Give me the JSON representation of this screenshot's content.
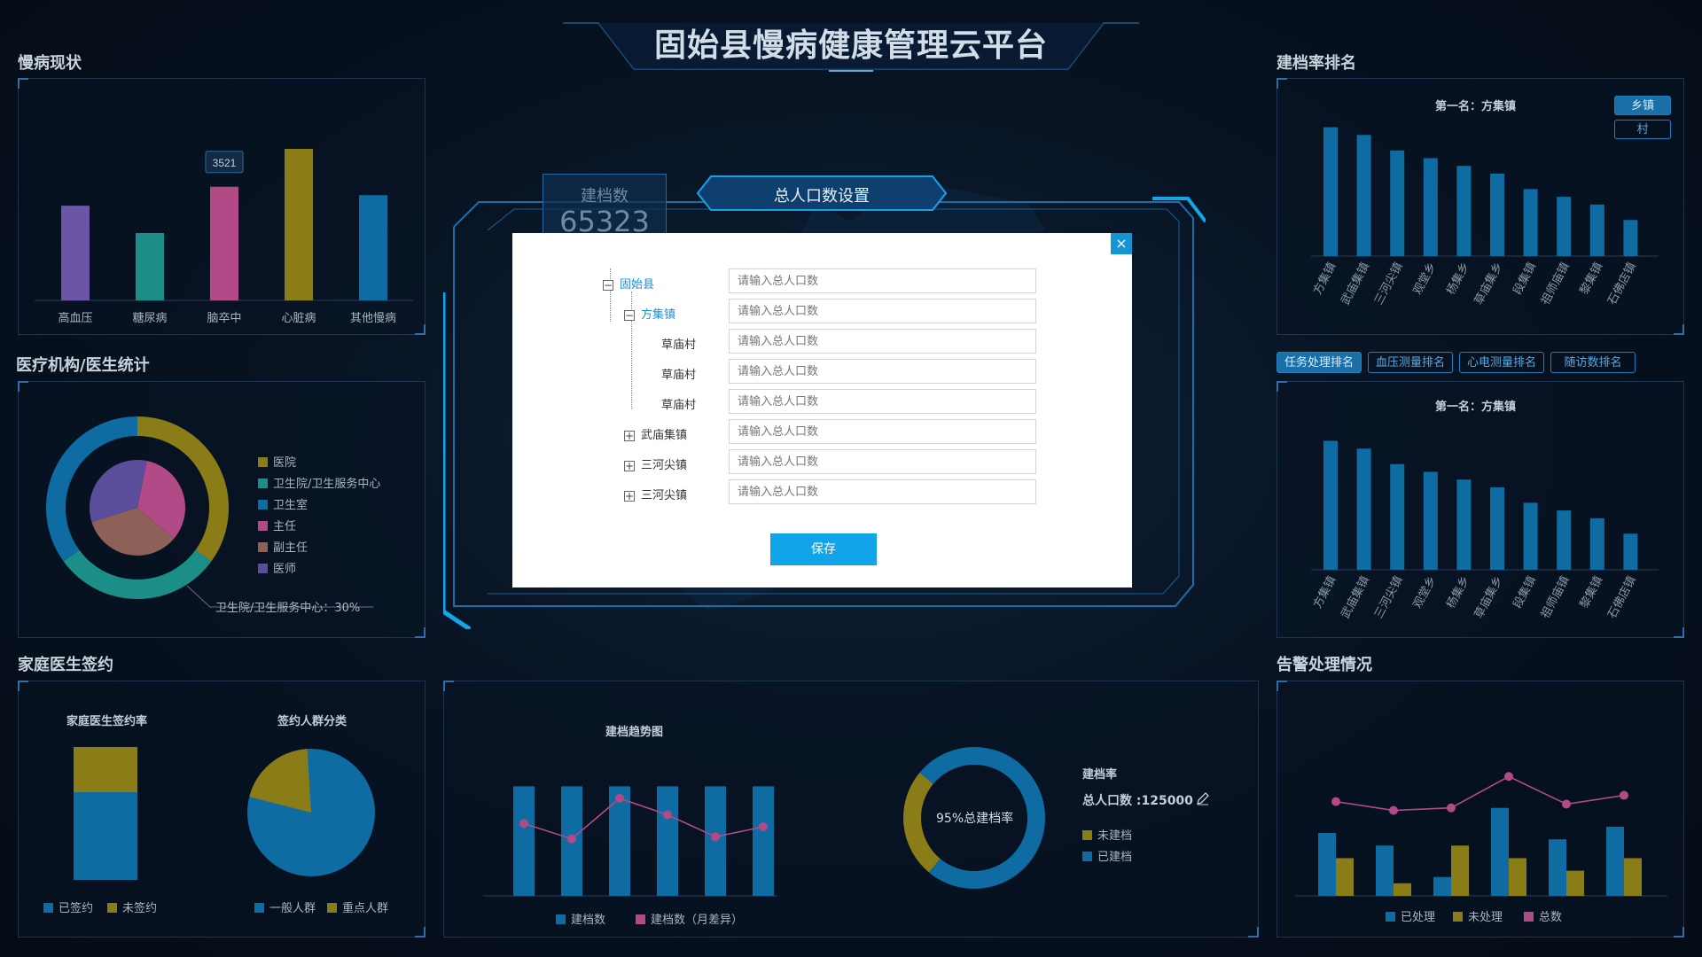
{
  "header": {
    "title": "固始县慢病健康管理云平台"
  },
  "chronic": {
    "title": "慢病现状",
    "chart_data": {
      "type": "bar",
      "categories": [
        "高血压",
        "糖尿病",
        "脑卒中",
        "心脏病",
        "其他慢病"
      ],
      "values": [
        2250,
        1600,
        2700,
        3600,
        2500
      ],
      "highlight": {
        "category": "脑卒中",
        "label": "3521"
      },
      "colors": [
        "#6a55a6",
        "#1b8f87",
        "#b14a86",
        "#8a7d17",
        "#0e6ca3"
      ],
      "ylim": [
        0,
        4000
      ]
    }
  },
  "medical": {
    "title": "医疗机构/医生统计",
    "legend": [
      "医院",
      "卫生院/卫生服务中心",
      "卫生室",
      "主任",
      "副主任",
      "医师"
    ],
    "legend_colors": [
      "#8a7d17",
      "#1b8f87",
      "#0e6ca3",
      "#b14a86",
      "#8d6157",
      "#5a4e9c"
    ],
    "callout": "卫生院/卫生服务中心：30%",
    "chart_data": [
      {
        "type": "pie",
        "name": "outer",
        "labels": [
          "医院",
          "卫生院/卫生服务中心",
          "卫生室"
        ],
        "values": [
          35,
          30,
          35
        ]
      },
      {
        "type": "pie",
        "name": "inner",
        "labels": [
          "主任",
          "副主任",
          "医师"
        ],
        "values": [
          33,
          34,
          33
        ]
      }
    ]
  },
  "family": {
    "title": "家庭医生签约",
    "rate_title": "家庭医生签约率",
    "crowd_title": "签约人群分类",
    "legend_rate": [
      "已签约",
      "未签约"
    ],
    "legend_crowd": [
      "一般人群",
      "重点人群"
    ],
    "colors": {
      "primary": "#0e6ca3",
      "secondary": "#8a7d17"
    },
    "chart_data": [
      {
        "type": "bar",
        "name": "签约率",
        "series": [
          {
            "name": "已签约",
            "values": [
              66
            ]
          },
          {
            "name": "未签约",
            "values": [
              34
            ]
          }
        ]
      },
      {
        "type": "pie",
        "name": "签约人群分类",
        "labels": [
          "一般人群",
          "重点人群"
        ],
        "values": [
          80,
          20
        ]
      }
    ]
  },
  "trend": {
    "title": "建档趋势图",
    "legend": [
      "建档数",
      "建档数（月差异）"
    ],
    "rate_title": "建档率",
    "total_label": "总人口数 :125000",
    "donut_text": "95%总建档率",
    "donut_legend": [
      "未建档",
      "已建档"
    ],
    "chart_data": [
      {
        "type": "bar",
        "series": [
          {
            "name": "建档数",
            "values": [
              100,
              100,
              100,
              100,
              100,
              100
            ]
          },
          {
            "name": "建档数（月差异）",
            "values": [
              66,
              52,
              89,
              74,
              54,
              63
            ]
          }
        ],
        "ylim": [
          0,
          110
        ]
      },
      {
        "type": "pie",
        "labels": [
          "未建档",
          "已建档"
        ],
        "values": [
          25,
          75
        ]
      }
    ]
  },
  "ranking": {
    "title": "建档率排名",
    "first": "第一名：方集镇",
    "first2": "第一名：方集镇",
    "scope_tabs": [
      "乡镇",
      "村"
    ],
    "tabs": [
      "任务处理排名",
      "血压测量排名",
      "心电测量排名",
      "随访数排名"
    ],
    "chart_data": [
      {
        "type": "bar",
        "categories": [
          "方集镇",
          "武庙集镇",
          "三河尖镇",
          "观堂乡",
          "杨集乡",
          "草庙集乡",
          "段集镇",
          "祖师庙镇",
          "黎集镇",
          "石佛店镇"
        ],
        "values": [
          100,
          94,
          82,
          76,
          70,
          64,
          52,
          46,
          40,
          28
        ],
        "ylim": [
          0,
          110
        ]
      },
      {
        "type": "bar",
        "categories": [
          "方集镇",
          "武庙集镇",
          "三河尖镇",
          "观堂乡",
          "杨集乡",
          "草庙集乡",
          "段集镇",
          "祖师庙镇",
          "黎集镇",
          "石佛店镇"
        ],
        "values": [
          100,
          94,
          82,
          76,
          70,
          64,
          52,
          46,
          40,
          28
        ],
        "ylim": [
          0,
          110
        ]
      }
    ]
  },
  "alarm": {
    "title": "告警处理情况",
    "legend": [
      "已处理",
      "未处理",
      "总数"
    ],
    "chart_data": {
      "type": "bar",
      "series": [
        {
          "name": "已处理",
          "values": [
            50,
            40,
            15,
            70,
            45,
            55
          ]
        },
        {
          "name": "未处理",
          "values": [
            30,
            10,
            40,
            30,
            20,
            30
          ]
        },
        {
          "name": "总数",
          "values": [
            75,
            68,
            70,
            95,
            73,
            80
          ]
        }
      ],
      "ylim": [
        0,
        110
      ]
    }
  },
  "overlay": {
    "count_label": "建档数",
    "count_value": "65323"
  },
  "modal": {
    "title": "总人口数设置",
    "close": "×",
    "save": "保存",
    "rows": [
      {
        "label": "固始县",
        "toggle": "−",
        "placeholder": "请输入总人口数"
      },
      {
        "label": "方集镇",
        "toggle": "−",
        "placeholder": "请输入总人口数"
      },
      {
        "label": "草庙村",
        "toggle": "",
        "placeholder": "请输入总人口数"
      },
      {
        "label": "草庙村",
        "toggle": "",
        "placeholder": "请输入总人口数"
      },
      {
        "label": "草庙村",
        "toggle": "",
        "placeholder": "请输入总人口数"
      },
      {
        "label": "武庙集镇",
        "toggle": "+",
        "placeholder": "请输入总人口数"
      },
      {
        "label": "三河尖镇",
        "toggle": "+",
        "placeholder": "请输入总人口数"
      },
      {
        "label": "三河尖镇",
        "toggle": "+",
        "placeholder": "请输入总人口数"
      }
    ]
  }
}
